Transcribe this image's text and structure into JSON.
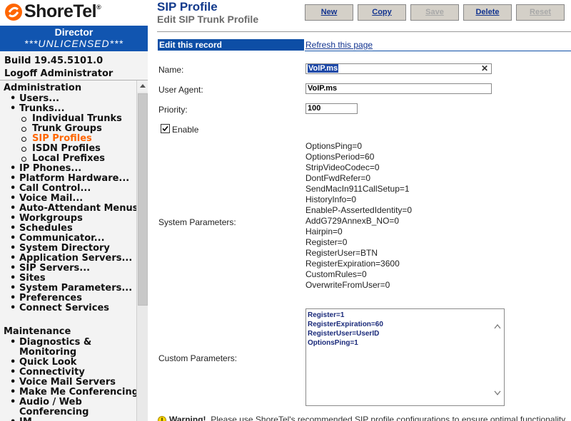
{
  "brand": {
    "name": "ShoreTel",
    "reg": "®"
  },
  "director": {
    "title": "Director",
    "license": "***UNLICENSED***"
  },
  "build": "Build 19.45.5101.0",
  "logoff": "Logoff Administrator",
  "nav": {
    "administration": "Administration",
    "admin_items": [
      {
        "label": "Users...",
        "level": 1
      },
      {
        "label": "Trunks...",
        "level": 1
      },
      {
        "label": "Individual Trunks",
        "level": 2
      },
      {
        "label": "Trunk Groups",
        "level": 2
      },
      {
        "label": "SIP Profiles",
        "level": 2,
        "active": true
      },
      {
        "label": "ISDN Profiles",
        "level": 2
      },
      {
        "label": "Local Prefixes",
        "level": 2
      },
      {
        "label": "IP Phones...",
        "level": 1
      },
      {
        "label": "Platform Hardware...",
        "level": 1
      },
      {
        "label": "Call Control...",
        "level": 1
      },
      {
        "label": "Voice Mail...",
        "level": 1
      },
      {
        "label": "Auto-Attendant Menus",
        "level": 1
      },
      {
        "label": "Workgroups",
        "level": 1
      },
      {
        "label": "Schedules",
        "level": 1
      },
      {
        "label": "Communicator...",
        "level": 1
      },
      {
        "label": "System Directory",
        "level": 1
      },
      {
        "label": "Application Servers...",
        "level": 1
      },
      {
        "label": "SIP Servers...",
        "level": 1
      },
      {
        "label": "Sites",
        "level": 1
      },
      {
        "label": "System Parameters...",
        "level": 1
      },
      {
        "label": "Preferences",
        "level": 1
      },
      {
        "label": "Connect Services",
        "level": 1
      }
    ],
    "maintenance": "Maintenance",
    "maint_items": [
      {
        "label": "Diagnostics &",
        "label2": "Monitoring"
      },
      {
        "label": "Quick Look"
      },
      {
        "label": "Connectivity"
      },
      {
        "label": "Voice Mail Servers"
      },
      {
        "label": "Make Me Conferencing"
      },
      {
        "label": "Audio / Web",
        "label2": "Conferencing"
      },
      {
        "label": "IM"
      }
    ]
  },
  "page": {
    "title": "SIP Profile",
    "subtitle": "Edit SIP Trunk Profile"
  },
  "toolbar": {
    "new": "New",
    "copy": "Copy",
    "save": "Save",
    "delete": "Delete",
    "reset": "Reset"
  },
  "form": {
    "edit_header": "Edit this record",
    "refresh": "Refresh this page",
    "name_label": "Name:",
    "name_value": "VoIP.ms",
    "clear_icon": "close-icon",
    "ua_label": "User Agent:",
    "ua_value": "VoIP.ms",
    "priority_label": "Priority:",
    "priority_value": "100",
    "enable_label": "Enable",
    "enable_checked": true,
    "system_label": "System Parameters:",
    "system_params": [
      "OptionsPing=0",
      "OptionsPeriod=60",
      "StripVideoCodec=0",
      "DontFwdRefer=0",
      "SendMacIn911CallSetup=1",
      "HistoryInfo=0",
      "EnableP-AssertedIdentity=0",
      "AddG729AnnexB_NO=0",
      "Hairpin=0",
      "Register=0",
      "RegisterUser=BTN",
      "RegisterExpiration=3600",
      "CustomRules=0",
      "OverwriteFromUser=0"
    ],
    "custom_label": "Custom Parameters:",
    "custom_params": [
      "Register=1",
      "RegisterExpiration=60",
      "RegisterUser=UserID",
      "OptionsPing=1"
    ]
  },
  "warning": {
    "icon": "warning-icon",
    "bold": "Warning!",
    "text": "Please use ShoreTel's recommended SIP profile configurations to ensure optimal functionality."
  }
}
